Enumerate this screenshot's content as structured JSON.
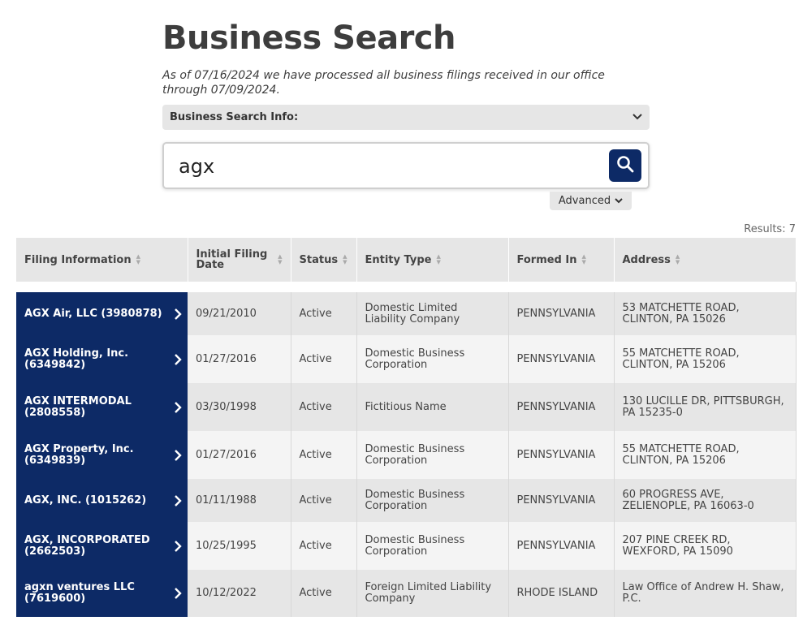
{
  "page": {
    "title": "Business Search",
    "subtitle": "As of 07/16/2024 we have processed all business filings received in our office through 07/09/2024."
  },
  "info_bar": {
    "label": "Business Search Info:",
    "icon": "chevron-down-icon"
  },
  "search": {
    "value": "agx",
    "button_icon": "search-icon"
  },
  "advanced": {
    "label": "Advanced",
    "icon": "chevron-down-icon"
  },
  "results": {
    "count_text": "Results: 7"
  },
  "table": {
    "columns": [
      "Filing Information",
      "Initial Filing Date",
      "Status",
      "Entity Type",
      "Formed In",
      "Address"
    ],
    "rows": [
      {
        "filing": "AGX Air, LLC (3980878)",
        "date": "09/21/2010",
        "status": "Active",
        "entity_type": "Domestic Limited Liability Company",
        "formed_in": "PENNSYLVANIA",
        "address": "53 MATCHETTE ROAD, CLINTON, PA 15026"
      },
      {
        "filing": "AGX Holding, Inc. (6349842)",
        "date": "01/27/2016",
        "status": "Active",
        "entity_type": "Domestic Business Corporation",
        "formed_in": "PENNSYLVANIA",
        "address": "55 MATCHETTE ROAD, CLINTON, PA 15206"
      },
      {
        "filing": "AGX INTERMODAL (2808558)",
        "date": "03/30/1998",
        "status": "Active",
        "entity_type": "Fictitious Name",
        "formed_in": "PENNSYLVANIA",
        "address": "130 LUCILLE DR, PITTSBURGH, PA 15235-0"
      },
      {
        "filing": "AGX Property, Inc. (6349839)",
        "date": "01/27/2016",
        "status": "Active",
        "entity_type": "Domestic Business Corporation",
        "formed_in": "PENNSYLVANIA",
        "address": "55 MATCHETTE ROAD, CLINTON, PA 15206"
      },
      {
        "filing": "AGX, INC. (1015262)",
        "date": "01/11/1988",
        "status": "Active",
        "entity_type": "Domestic Business Corporation",
        "formed_in": "PENNSYLVANIA",
        "address": "60 PROGRESS AVE, ZELIENOPLE, PA 16063-0"
      },
      {
        "filing": "AGX, INCORPORATED (2662503)",
        "date": "10/25/1995",
        "status": "Active",
        "entity_type": "Domestic Business Corporation",
        "formed_in": "PENNSYLVANIA",
        "address": "207 PINE CREEK RD, WEXFORD, PA 15090"
      },
      {
        "filing": "agxn ventures LLC (7619600)",
        "date": "10/12/2022",
        "status": "Active",
        "entity_type": "Foreign Limited Liability Company",
        "formed_in": "RHODE ISLAND",
        "address": "Law Office of Andrew H. Shaw, P.C."
      }
    ]
  },
  "colors": {
    "navy": "#0d2a66",
    "header_gray": "#e6e6e6",
    "row_light": "#f4f4f4"
  }
}
